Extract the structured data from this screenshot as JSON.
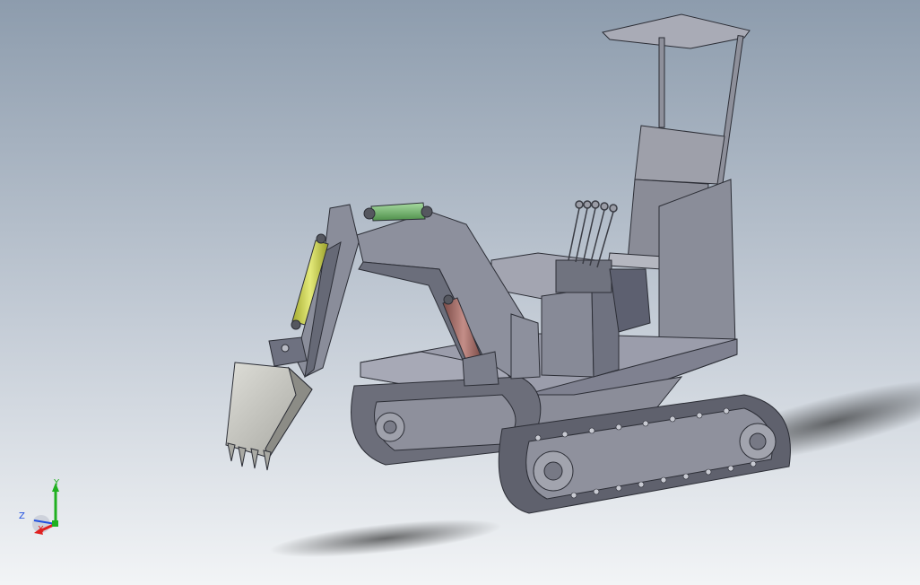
{
  "viewport": {
    "background_top": "#8d9cad",
    "background_bottom": "#f2f4f6"
  },
  "model": {
    "body_color": "#9698a4",
    "dark_color": "#4a4c58",
    "bucket_color": "#c9c9c4",
    "cylinder_yellow": "#d2d85a",
    "cylinder_green": "#7dbf78",
    "cylinder_red": "#a8726c"
  },
  "triad": {
    "x_label": "X",
    "y_label": "Y",
    "z_label": "Z",
    "x_color": "#e02020",
    "y_color": "#20b020",
    "z_color": "#2050e0"
  }
}
